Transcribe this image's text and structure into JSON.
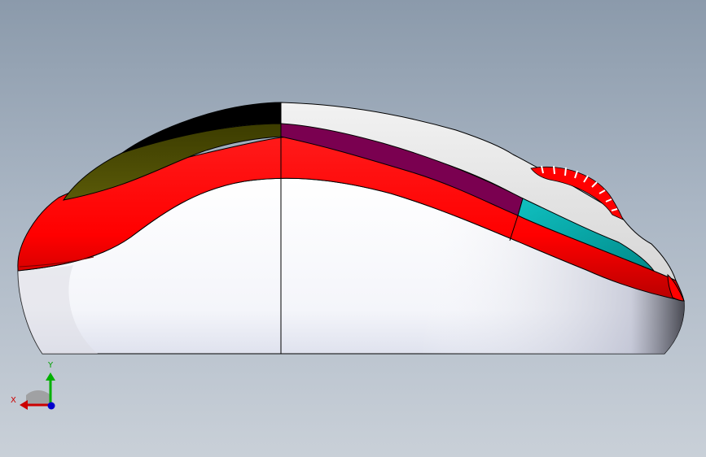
{
  "viewport": {
    "background_top": "#8b9aab",
    "background_bottom": "#c9d0d8"
  },
  "model": {
    "parts": [
      {
        "name": "base-shell",
        "color": "#ffffff"
      },
      {
        "name": "side-band",
        "color": "#ff0000"
      },
      {
        "name": "rear-cap",
        "color": "#000000"
      },
      {
        "name": "olive-panel",
        "color": "#4a4a00"
      },
      {
        "name": "top-shell",
        "color": "#e6e6e6"
      },
      {
        "name": "purple-strip",
        "color": "#7a0050"
      },
      {
        "name": "teal-panel",
        "color": "#00a8a8"
      },
      {
        "name": "scroll-wheel",
        "color": "#ff0000"
      }
    ]
  },
  "triad": {
    "x_label": "X",
    "y_label": "Y",
    "x_color": "#cc0000",
    "y_color": "#00b000",
    "z_color": "#0000cc"
  }
}
